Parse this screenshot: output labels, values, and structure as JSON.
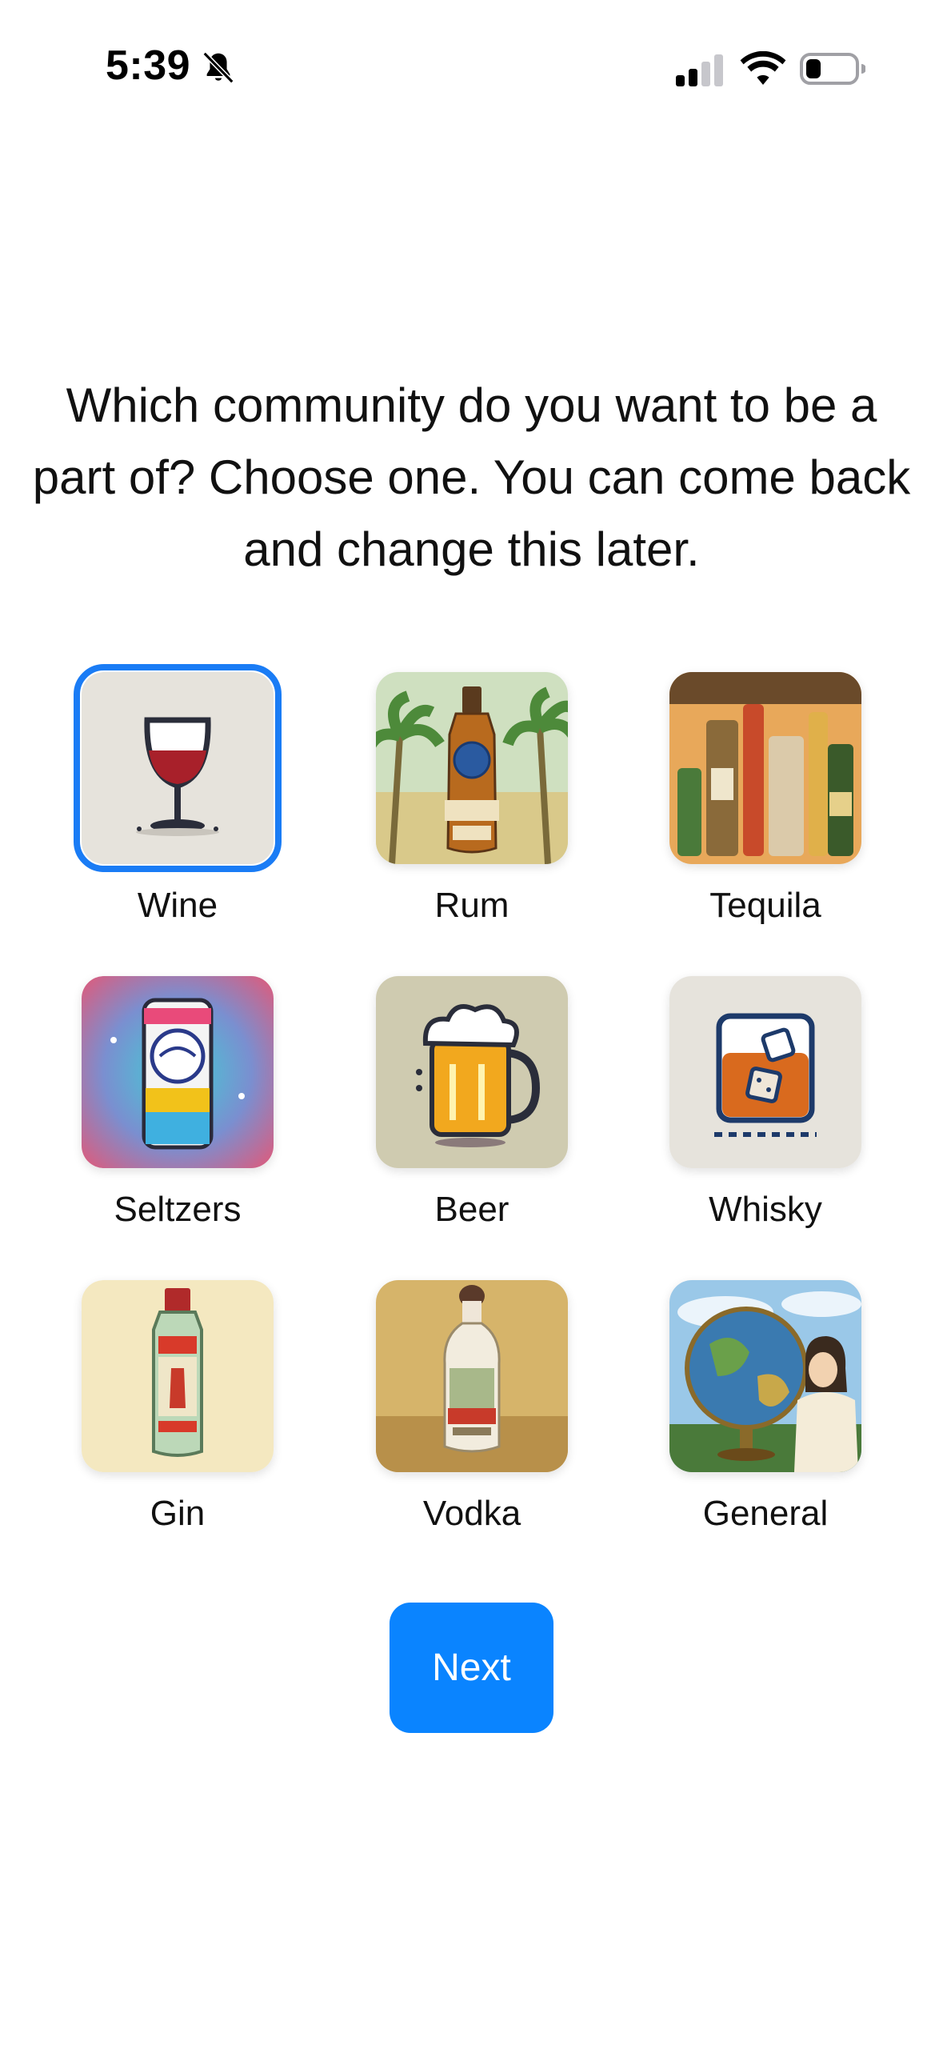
{
  "status_bar": {
    "time": "5:39",
    "icons": [
      "bell-slash-icon",
      "cellular-signal-icon",
      "wifi-icon",
      "battery-icon"
    ]
  },
  "heading": "Which community do you want to be a part of? Choose one. You can come back and change this later.",
  "communities": [
    {
      "label": "Wine",
      "icon": "wine-glass-icon",
      "selected": true
    },
    {
      "label": "Rum",
      "icon": "rum-bottle-icon",
      "selected": false
    },
    {
      "label": "Tequila",
      "icon": "tequila-bottles-icon",
      "selected": false
    },
    {
      "label": "Seltzers",
      "icon": "seltzer-can-icon",
      "selected": false
    },
    {
      "label": "Beer",
      "icon": "beer-mug-icon",
      "selected": false
    },
    {
      "label": "Whisky",
      "icon": "whisky-glass-icon",
      "selected": false
    },
    {
      "label": "Gin",
      "icon": "gin-bottle-icon",
      "selected": false
    },
    {
      "label": "Vodka",
      "icon": "vodka-bottle-icon",
      "selected": false
    },
    {
      "label": "General",
      "icon": "globe-icon",
      "selected": false
    }
  ],
  "next_button": "Next",
  "colors": {
    "accent": "#0a84ff",
    "selection_outline": "#1a7cf5"
  }
}
